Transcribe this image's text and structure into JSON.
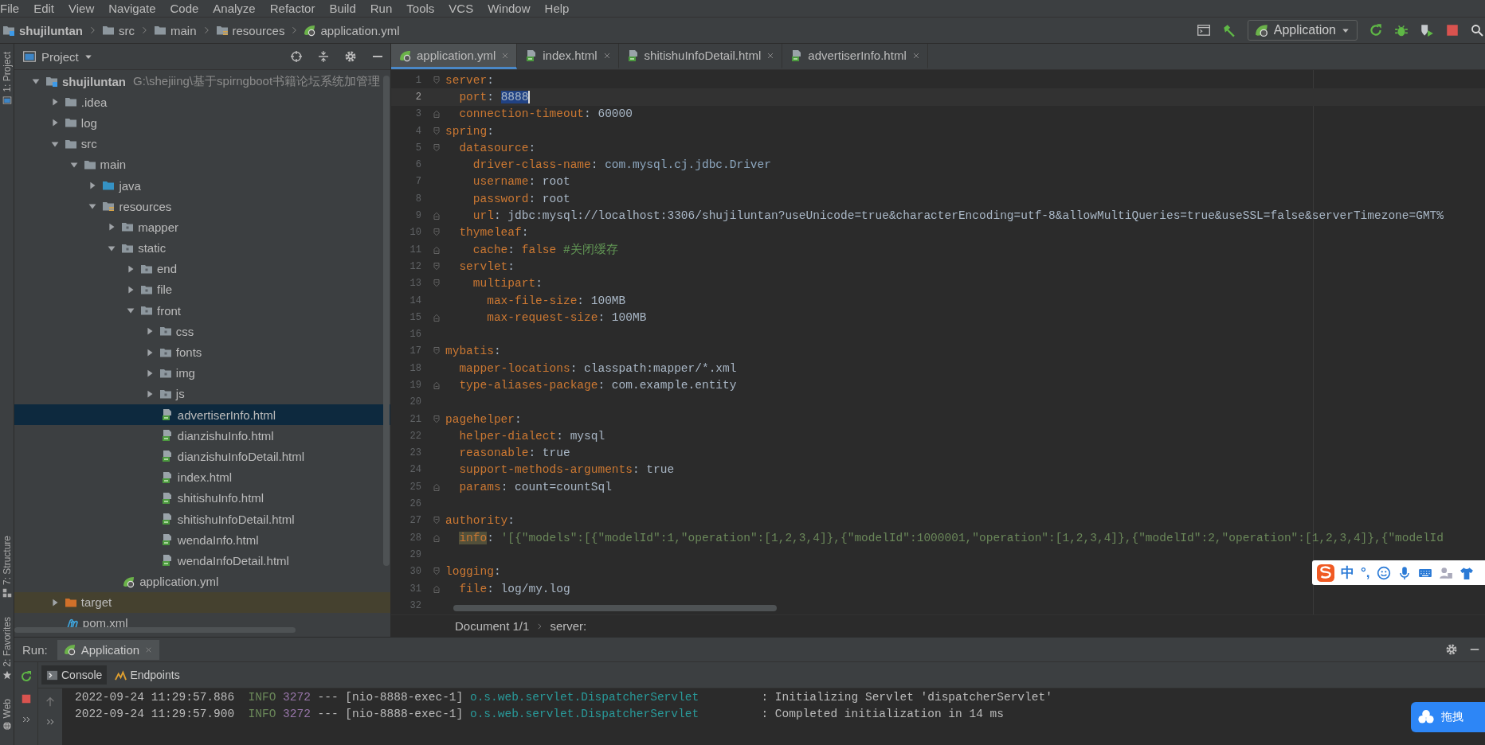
{
  "menu": [
    "File",
    "Edit",
    "View",
    "Navigate",
    "Code",
    "Analyze",
    "Refactor",
    "Build",
    "Run",
    "Tools",
    "VCS",
    "Window",
    "Help"
  ],
  "navigation_bar": {
    "breadcrumbs": [
      {
        "label": "shujiluntan",
        "kind": "folder-module"
      },
      {
        "label": "src",
        "kind": "folder"
      },
      {
        "label": "main",
        "kind": "folder"
      },
      {
        "label": "resources",
        "kind": "folder-resources"
      },
      {
        "label": "application.yml",
        "kind": "yml"
      }
    ],
    "run_configuration": "Application"
  },
  "left_stripe": {
    "top": [
      "1: Project"
    ],
    "bottom": [
      "7: Structure",
      "2: Favorites",
      "Web"
    ]
  },
  "project_panel": {
    "title": "Project",
    "tree": [
      {
        "label": "shujiluntan",
        "path": "G:\\shejiing\\基于spirngboot书籍论坛系统加管理",
        "kind": "folder-module",
        "expanded": true,
        "selected": false,
        "children": [
          {
            "label": ".idea",
            "kind": "folder",
            "expanded": false,
            "selected": false
          },
          {
            "label": "log",
            "kind": "folder",
            "expanded": false,
            "selected": false
          },
          {
            "label": "src",
            "kind": "folder",
            "expanded": true,
            "selected": false,
            "children": [
              {
                "label": "main",
                "kind": "folder",
                "expanded": true,
                "selected": false,
                "children": [
                  {
                    "label": "java",
                    "kind": "folder-source",
                    "expanded": false,
                    "selected": false
                  },
                  {
                    "label": "resources",
                    "kind": "folder-resources",
                    "expanded": true,
                    "selected": false,
                    "children": [
                      {
                        "label": "mapper",
                        "kind": "folder-web",
                        "expanded": false,
                        "selected": false
                      },
                      {
                        "label": "static",
                        "kind": "folder-web",
                        "expanded": true,
                        "selected": false,
                        "children": [
                          {
                            "label": "end",
                            "kind": "folder-web",
                            "expanded": false,
                            "selected": false
                          },
                          {
                            "label": "file",
                            "kind": "folder-web",
                            "expanded": false,
                            "selected": false
                          },
                          {
                            "label": "front",
                            "kind": "folder-web",
                            "expanded": true,
                            "selected": false,
                            "children": [
                              {
                                "label": "css",
                                "kind": "folder-web",
                                "expanded": false,
                                "selected": false
                              },
                              {
                                "label": "fonts",
                                "kind": "folder-web",
                                "expanded": false,
                                "selected": false
                              },
                              {
                                "label": "img",
                                "kind": "folder-web",
                                "expanded": false,
                                "selected": false
                              },
                              {
                                "label": "js",
                                "kind": "folder-web",
                                "expanded": false,
                                "selected": false
                              },
                              {
                                "label": "advertiserInfo.html",
                                "kind": "html",
                                "selected": true
                              },
                              {
                                "label": "dianzishuInfo.html",
                                "kind": "html",
                                "selected": false
                              },
                              {
                                "label": "dianzishuInfoDetail.html",
                                "kind": "html",
                                "selected": false
                              },
                              {
                                "label": "index.html",
                                "kind": "html",
                                "selected": false
                              },
                              {
                                "label": "shitishuInfo.html",
                                "kind": "html",
                                "selected": false
                              },
                              {
                                "label": "shitishuInfoDetail.html",
                                "kind": "html",
                                "selected": false
                              },
                              {
                                "label": "wendaInfo.html",
                                "kind": "html",
                                "selected": false
                              },
                              {
                                "label": "wendaInfoDetail.html",
                                "kind": "html",
                                "selected": false
                              }
                            ]
                          }
                        ]
                      },
                      {
                        "label": "application.yml",
                        "kind": "yml",
                        "selected": false
                      }
                    ]
                  }
                ]
              }
            ]
          },
          {
            "label": "target",
            "kind": "folder-excluded",
            "expanded": false,
            "selected": false
          },
          {
            "label": "pom.xml",
            "kind": "maven",
            "selected": false
          }
        ]
      }
    ]
  },
  "editor": {
    "tabs": [
      {
        "label": "application.yml",
        "kind": "yml",
        "selected": true
      },
      {
        "label": "index.html",
        "kind": "html",
        "selected": false
      },
      {
        "label": "shitishuInfoDetail.html",
        "kind": "html",
        "selected": false
      },
      {
        "label": "advertiserInfo.html",
        "kind": "html",
        "selected": false
      }
    ],
    "lines": [
      {
        "number": "1",
        "fold_open": true,
        "current": false,
        "segments": [
          {
            "kind": "key",
            "text": "server"
          },
          {
            "kind": "plain",
            "text": ":"
          }
        ]
      },
      {
        "number": "2",
        "current": true,
        "segments": [
          {
            "kind": "key",
            "text": "  port"
          },
          {
            "kind": "plain",
            "text": ": "
          },
          {
            "kind": "selection",
            "text": "8888"
          }
        ]
      },
      {
        "number": "3",
        "fold_close": true,
        "current": false,
        "segments": [
          {
            "kind": "key",
            "text": "  connection-timeout"
          },
          {
            "kind": "plain",
            "text": ": 60000"
          }
        ]
      },
      {
        "number": "4",
        "fold_open": true,
        "current": false,
        "segments": [
          {
            "kind": "key",
            "text": "spring"
          },
          {
            "kind": "plain",
            "text": ":"
          }
        ]
      },
      {
        "number": "5",
        "fold_open": true,
        "current": false,
        "segments": [
          {
            "kind": "key",
            "text": "  datasource"
          },
          {
            "kind": "plain",
            "text": ":"
          }
        ]
      },
      {
        "number": "6",
        "current": false,
        "segments": [
          {
            "kind": "key",
            "text": "    driver-class-name"
          },
          {
            "kind": "plain",
            "text": ": "
          },
          {
            "kind": "reference",
            "text": "com.mysql.cj.jdbc.Driver"
          }
        ]
      },
      {
        "number": "7",
        "current": false,
        "segments": [
          {
            "kind": "key",
            "text": "    username"
          },
          {
            "kind": "plain",
            "text": ": root"
          }
        ]
      },
      {
        "number": "8",
        "current": false,
        "segments": [
          {
            "kind": "key",
            "text": "    password"
          },
          {
            "kind": "plain",
            "text": ": root"
          }
        ]
      },
      {
        "number": "9",
        "fold_close": true,
        "current": false,
        "segments": [
          {
            "kind": "key",
            "text": "    url"
          },
          {
            "kind": "plain",
            "text": ": jdbc:mysql://localhost:3306/shujiluntan?useUnicode=true&characterEncoding=utf-8&allowMultiQueries=true&useSSL=false&serverTimezone=GMT%"
          }
        ]
      },
      {
        "number": "10",
        "fold_open": true,
        "current": false,
        "segments": [
          {
            "kind": "key",
            "text": "  thymeleaf"
          },
          {
            "kind": "plain",
            "text": ":"
          }
        ]
      },
      {
        "number": "11",
        "fold_close": true,
        "current": false,
        "segments": [
          {
            "kind": "key",
            "text": "    cache"
          },
          {
            "kind": "plain",
            "text": ": "
          },
          {
            "kind": "keyword",
            "text": "false"
          },
          {
            "kind": "comment",
            "text": " #关闭缓存"
          }
        ]
      },
      {
        "number": "12",
        "fold_open": true,
        "current": false,
        "segments": [
          {
            "kind": "key",
            "text": "  servlet"
          },
          {
            "kind": "plain",
            "text": ":"
          }
        ]
      },
      {
        "number": "13",
        "fold_open": true,
        "current": false,
        "segments": [
          {
            "kind": "key",
            "text": "    multipart"
          },
          {
            "kind": "plain",
            "text": ":"
          }
        ]
      },
      {
        "number": "14",
        "current": false,
        "segments": [
          {
            "kind": "key",
            "text": "      max-file-size"
          },
          {
            "kind": "plain",
            "text": ": 100MB"
          }
        ]
      },
      {
        "number": "15",
        "fold_close": true,
        "current": false,
        "segments": [
          {
            "kind": "key",
            "text": "      max-request-size"
          },
          {
            "kind": "plain",
            "text": ": 100MB"
          }
        ]
      },
      {
        "number": "16",
        "current": false
      },
      {
        "number": "17",
        "fold_open": true,
        "current": false,
        "segments": [
          {
            "kind": "key",
            "text": "mybatis"
          },
          {
            "kind": "plain",
            "text": ":"
          }
        ]
      },
      {
        "number": "18",
        "current": false,
        "segments": [
          {
            "kind": "key",
            "text": "  mapper-locations"
          },
          {
            "kind": "plain",
            "text": ": classpath:mapper/*.xml"
          }
        ]
      },
      {
        "number": "19",
        "fold_close": true,
        "current": false,
        "segments": [
          {
            "kind": "key",
            "text": "  type-aliases-package"
          },
          {
            "kind": "plain",
            "text": ": com.example.entity"
          }
        ]
      },
      {
        "number": "20",
        "current": false
      },
      {
        "number": "21",
        "fold_open": true,
        "current": false,
        "segments": [
          {
            "kind": "key",
            "text": "pagehelper"
          },
          {
            "kind": "plain",
            "text": ":"
          }
        ]
      },
      {
        "number": "22",
        "current": false,
        "segments": [
          {
            "kind": "key",
            "text": "  helper-dialect"
          },
          {
            "kind": "plain",
            "text": ": mysql"
          }
        ]
      },
      {
        "number": "23",
        "current": false,
        "segments": [
          {
            "kind": "key",
            "text": "  reasonable"
          },
          {
            "kind": "plain",
            "text": ": true"
          }
        ]
      },
      {
        "number": "24",
        "current": false,
        "segments": [
          {
            "kind": "key",
            "text": "  support-methods-arguments"
          },
          {
            "kind": "plain",
            "text": ": true"
          }
        ]
      },
      {
        "number": "25",
        "fold_close": true,
        "current": false,
        "segments": [
          {
            "kind": "key",
            "text": "  params"
          },
          {
            "kind": "plain",
            "text": ": count=countSql"
          }
        ]
      },
      {
        "number": "26",
        "current": false
      },
      {
        "number": "27",
        "fold_open": true,
        "current": false,
        "segments": [
          {
            "kind": "key",
            "text": "authority"
          },
          {
            "kind": "plain",
            "text": ":"
          }
        ]
      },
      {
        "number": "28",
        "fold_close": true,
        "current": false,
        "segments": [
          {
            "kind": "key-highlight",
            "text": "  info"
          },
          {
            "kind": "plain",
            "text": ": "
          },
          {
            "kind": "string",
            "text": "'[{\"models\":[{\"modelId\":1,\"operation\":[1,2,3,4]},{\"modelId\":1000001,\"operation\":[1,2,3,4]},{\"modelId\":2,\"operation\":[1,2,3,4]},{\"modelId"
          }
        ]
      },
      {
        "number": "29",
        "current": false
      },
      {
        "number": "30",
        "fold_open": true,
        "current": false,
        "segments": [
          {
            "kind": "key",
            "text": "logging"
          },
          {
            "kind": "plain",
            "text": ":"
          }
        ]
      },
      {
        "number": "31",
        "fold_close": true,
        "current": false,
        "segments": [
          {
            "kind": "key",
            "text": "  file"
          },
          {
            "kind": "plain",
            "text": ": log/my.log"
          }
        ]
      },
      {
        "number": "32",
        "current": false
      }
    ],
    "breadcrumbs": [
      "Document 1/1",
      "server:"
    ]
  },
  "ime_toolbar": {
    "mode": "中",
    "punctuation": "°,"
  },
  "run_panel": {
    "label": "Run:",
    "tabs": [
      {
        "label": "Application",
        "selected": true
      }
    ],
    "console_tabs": [
      {
        "label": "Console",
        "kind": "console",
        "selected": true
      },
      {
        "label": "Endpoints",
        "kind": "endpoints",
        "selected": false
      }
    ],
    "log_lines": [
      {
        "timestamp": "2022-09-24 11:29:57.886",
        "level": "INFO",
        "pid": "3272",
        "separator": "---",
        "thread": "[nio-8888-exec-1]",
        "logger": "o.s.web.servlet.DispatcherServlet",
        "message": ": Initializing Servlet 'dispatcherServlet'"
      },
      {
        "timestamp": "2022-09-24 11:29:57.900",
        "level": "INFO",
        "pid": "3272",
        "separator": "---",
        "thread": "[nio-8888-exec-1]",
        "logger": "o.s.web.servlet.DispatcherServlet",
        "message": ": Completed initialization in 14 ms"
      }
    ]
  },
  "floating_button": {
    "label": "拖拽"
  }
}
